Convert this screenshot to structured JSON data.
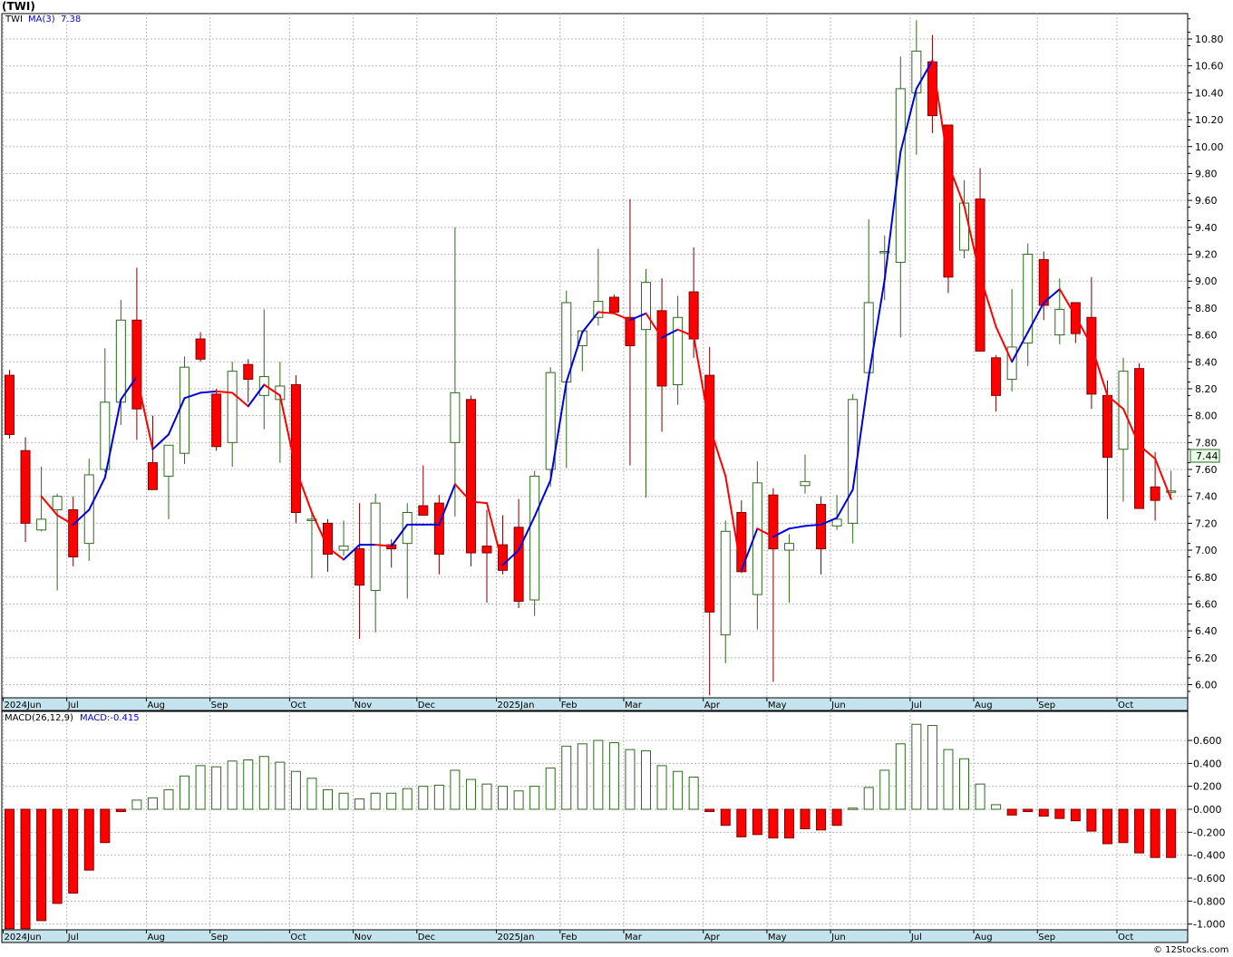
{
  "header": {
    "title": "(TWI)"
  },
  "credit": "© 12Stocks.com",
  "colors": {
    "up_body": "#ffffff",
    "up_stroke": "#2e6b1e",
    "down_body": "#ff0000",
    "down_stroke": "#7a0000",
    "ma_up": "#0000dd",
    "ma_down": "#ff0000",
    "axis_strip": "#c4e3ec",
    "price_badge": "#e6ffe6"
  },
  "chart_data": [
    {
      "type": "candlestick",
      "panel": "price",
      "legend": {
        "symbol": "TWI",
        "ma_label": "MA(3)",
        "ma_value": "7.38"
      },
      "last_price_label": "7.44",
      "ylim": [
        5.92,
        10.95
      ],
      "y_ticks": [
        "6.00",
        "6.20",
        "6.40",
        "6.60",
        "6.80",
        "7.00",
        "7.20",
        "7.40",
        "7.60",
        "7.80",
        "8.00",
        "8.20",
        "8.40",
        "8.60",
        "8.80",
        "9.00",
        "9.20",
        "9.40",
        "9.60",
        "9.80",
        "10.00",
        "10.20",
        "10.40",
        "10.60",
        "10.80"
      ],
      "x_labels": [
        {
          "label": "2024Jun",
          "i": 0
        },
        {
          "label": "Jul",
          "i": 4
        },
        {
          "label": "Aug",
          "i": 9
        },
        {
          "label": "Sep",
          "i": 13
        },
        {
          "label": "Oct",
          "i": 18
        },
        {
          "label": "Nov",
          "i": 22
        },
        {
          "label": "Dec",
          "i": 26
        },
        {
          "label": "2025Jan",
          "i": 31
        },
        {
          "label": "Feb",
          "i": 35
        },
        {
          "label": "Mar",
          "i": 39
        },
        {
          "label": "Apr",
          "i": 44
        },
        {
          "label": "May",
          "i": 48
        },
        {
          "label": "Jun",
          "i": 52
        },
        {
          "label": "Jul",
          "i": 57
        },
        {
          "label": "Aug",
          "i": 61
        },
        {
          "label": "Sep",
          "i": 65
        },
        {
          "label": "Oct",
          "i": 70
        }
      ],
      "ohlc": [
        [
          8.3,
          8.34,
          7.83,
          7.86
        ],
        [
          7.74,
          7.84,
          7.06,
          7.2
        ],
        [
          7.15,
          7.62,
          7.14,
          7.23
        ],
        [
          7.3,
          7.42,
          6.7,
          7.4
        ],
        [
          7.3,
          7.4,
          6.88,
          6.95
        ],
        [
          7.05,
          7.68,
          6.92,
          7.56
        ],
        [
          7.6,
          8.5,
          7.58,
          8.1
        ],
        [
          8.1,
          8.86,
          7.93,
          8.71
        ],
        [
          8.71,
          9.1,
          7.82,
          8.05
        ],
        [
          7.65,
          8.0,
          7.46,
          7.45
        ],
        [
          7.55,
          7.72,
          7.23,
          7.78
        ],
        [
          7.72,
          8.44,
          7.64,
          8.36
        ],
        [
          8.57,
          8.62,
          8.4,
          8.42
        ],
        [
          8.16,
          8.2,
          7.74,
          7.77
        ],
        [
          7.8,
          8.4,
          7.62,
          8.33
        ],
        [
          8.38,
          8.42,
          8.1,
          8.27
        ],
        [
          8.15,
          8.79,
          7.9,
          8.29
        ],
        [
          8.12,
          8.4,
          7.65,
          8.22
        ],
        [
          8.23,
          8.3,
          7.2,
          7.28
        ],
        [
          7.22,
          7.28,
          6.79,
          7.23
        ],
        [
          7.2,
          7.23,
          6.84,
          6.97
        ],
        [
          7.0,
          7.22,
          6.96,
          7.03
        ],
        [
          7.01,
          7.35,
          6.34,
          6.74
        ],
        [
          6.7,
          7.42,
          6.39,
          7.35
        ],
        [
          7.04,
          7.08,
          6.87,
          7.01
        ],
        [
          7.05,
          7.35,
          6.64,
          7.28
        ],
        [
          7.33,
          7.63,
          7.26,
          7.26
        ],
        [
          7.35,
          7.41,
          6.82,
          6.97
        ],
        [
          7.8,
          9.4,
          7.25,
          8.17
        ],
        [
          8.12,
          8.15,
          6.88,
          6.98
        ],
        [
          7.03,
          7.3,
          6.61,
          6.98
        ],
        [
          7.04,
          7.26,
          6.82,
          6.85
        ],
        [
          7.17,
          7.38,
          6.57,
          6.62
        ],
        [
          6.63,
          7.59,
          6.51,
          7.55
        ],
        [
          7.6,
          8.36,
          7.47,
          8.32
        ],
        [
          8.25,
          8.93,
          7.61,
          8.84
        ],
        [
          8.52,
          8.63,
          8.33,
          8.63
        ],
        [
          8.73,
          9.24,
          8.67,
          8.85
        ],
        [
          8.88,
          8.9,
          8.76,
          8.77
        ],
        [
          8.73,
          9.61,
          7.63,
          8.52
        ],
        [
          8.64,
          9.09,
          7.39,
          8.99
        ],
        [
          8.78,
          9.02,
          7.88,
          8.22
        ],
        [
          8.23,
          8.89,
          8.08,
          8.73
        ],
        [
          8.92,
          9.25,
          8.43,
          8.57
        ],
        [
          8.3,
          8.51,
          5.92,
          6.54
        ],
        [
          6.37,
          7.22,
          6.16,
          7.14
        ],
        [
          7.28,
          7.37,
          6.83,
          6.84
        ],
        [
          6.67,
          7.66,
          6.41,
          7.5
        ],
        [
          7.41,
          7.46,
          6.02,
          7.01
        ],
        [
          7.0,
          7.12,
          6.61,
          7.05
        ],
        [
          7.48,
          7.71,
          7.42,
          7.51
        ],
        [
          7.34,
          7.4,
          6.82,
          7.01
        ],
        [
          7.18,
          7.41,
          7.15,
          7.23
        ],
        [
          7.2,
          8.16,
          7.05,
          8.12
        ],
        [
          8.32,
          9.46,
          8.28,
          8.84
        ],
        [
          9.22,
          9.34,
          8.86,
          9.22
        ],
        [
          9.14,
          10.67,
          8.58,
          10.43
        ],
        [
          10.4,
          10.94,
          9.94,
          10.71
        ],
        [
          10.63,
          10.83,
          10.1,
          10.23
        ],
        [
          10.16,
          10.16,
          8.91,
          9.03
        ],
        [
          9.23,
          9.75,
          9.17,
          9.58
        ],
        [
          9.61,
          9.84,
          8.5,
          8.48
        ],
        [
          8.43,
          8.45,
          8.03,
          8.15
        ],
        [
          8.27,
          8.94,
          8.18,
          8.51
        ],
        [
          8.54,
          9.28,
          8.37,
          9.2
        ],
        [
          9.16,
          9.22,
          8.71,
          8.82
        ],
        [
          8.6,
          9.02,
          8.53,
          8.79
        ],
        [
          8.84,
          8.84,
          8.54,
          8.61
        ],
        [
          8.73,
          9.03,
          8.05,
          8.16
        ],
        [
          8.15,
          8.26,
          7.23,
          7.69
        ],
        [
          7.75,
          8.43,
          7.36,
          8.33
        ],
        [
          8.35,
          8.39,
          7.31,
          7.31
        ],
        [
          7.47,
          7.73,
          7.22,
          7.37
        ],
        [
          7.44,
          7.59,
          7.39,
          7.44
        ]
      ],
      "ma3": [
        null,
        null,
        7.4,
        7.26,
        7.19,
        7.3,
        7.54,
        8.12,
        8.29,
        7.75,
        7.86,
        8.13,
        8.17,
        8.18,
        8.17,
        8.07,
        8.23,
        8.15,
        7.6,
        7.28,
        7.02,
        6.93,
        7.04,
        7.04,
        7.03,
        7.19,
        7.19,
        7.19,
        7.49,
        7.36,
        7.35,
        6.89,
        7.0,
        7.25,
        7.52,
        8.25,
        8.62,
        8.77,
        8.76,
        8.71,
        8.76,
        8.58,
        8.64,
        8.59,
        7.92,
        7.55,
        6.85,
        7.16,
        7.1,
        7.16,
        7.18,
        7.19,
        7.24,
        7.45,
        8.29,
        9.01,
        9.96,
        10.43,
        10.64,
        9.87,
        9.56,
        9.04,
        8.66,
        8.4,
        8.62,
        8.84,
        8.94,
        8.74,
        8.52,
        8.15,
        8.05,
        7.78,
        7.68,
        7.38
      ]
    },
    {
      "type": "bar",
      "panel": "macd",
      "legend": {
        "label": "MACD(26,12,9)",
        "value_label": "MACD:-0.415"
      },
      "ylim": [
        -1.05,
        0.78
      ],
      "y_ticks": [
        "-1.000",
        "-0.800",
        "-0.600",
        "-0.400",
        "-0.200",
        "0.000",
        "0.200",
        "0.400",
        "0.600"
      ],
      "x_labels": [
        {
          "label": "2024Jun",
          "i": 0
        },
        {
          "label": "Jul",
          "i": 4
        },
        {
          "label": "Aug",
          "i": 9
        },
        {
          "label": "Sep",
          "i": 13
        },
        {
          "label": "Oct",
          "i": 18
        },
        {
          "label": "Nov",
          "i": 22
        },
        {
          "label": "Dec",
          "i": 26
        },
        {
          "label": "2025Jan",
          "i": 31
        },
        {
          "label": "Feb",
          "i": 35
        },
        {
          "label": "Mar",
          "i": 39
        },
        {
          "label": "Apr",
          "i": 44
        },
        {
          "label": "May",
          "i": 48
        },
        {
          "label": "Jun",
          "i": 52
        },
        {
          "label": "Jul",
          "i": 57
        },
        {
          "label": "Aug",
          "i": 61
        },
        {
          "label": "Sep",
          "i": 65
        },
        {
          "label": "Oct",
          "i": 70
        }
      ],
      "values": [
        -1.04,
        -1.04,
        -0.97,
        -0.82,
        -0.73,
        -0.53,
        -0.29,
        -0.02,
        0.08,
        0.1,
        0.17,
        0.29,
        0.38,
        0.37,
        0.42,
        0.43,
        0.46,
        0.41,
        0.33,
        0.27,
        0.17,
        0.14,
        0.09,
        0.14,
        0.14,
        0.18,
        0.2,
        0.21,
        0.34,
        0.26,
        0.22,
        0.2,
        0.16,
        0.2,
        0.36,
        0.55,
        0.57,
        0.6,
        0.58,
        0.52,
        0.51,
        0.38,
        0.33,
        0.28,
        -0.02,
        -0.14,
        -0.24,
        -0.22,
        -0.25,
        -0.25,
        -0.17,
        -0.18,
        -0.14,
        0.01,
        0.19,
        0.34,
        0.57,
        0.74,
        0.73,
        0.52,
        0.44,
        0.22,
        0.04,
        -0.05,
        -0.02,
        -0.06,
        -0.08,
        -0.1,
        -0.19,
        -0.3,
        -0.29,
        -0.38,
        -0.42,
        -0.42
      ]
    }
  ]
}
